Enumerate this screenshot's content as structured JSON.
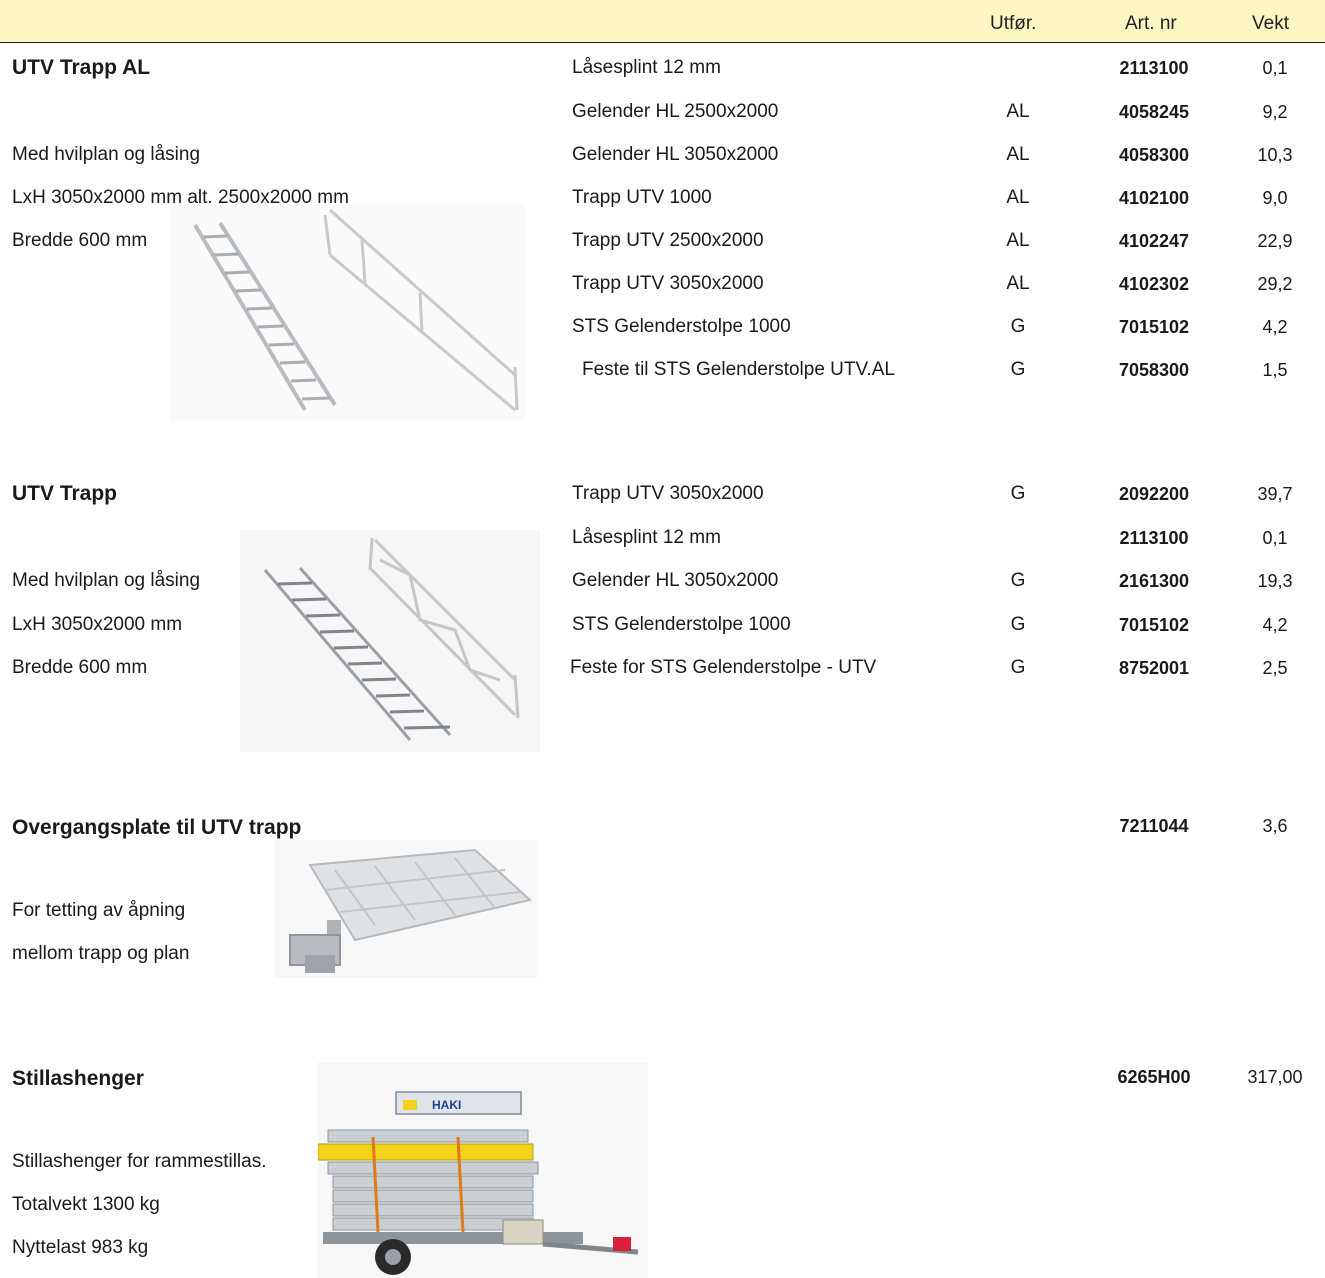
{
  "header": {
    "utfor": "Utfør.",
    "artnr": "Art. nr",
    "vekt": "Vekt"
  },
  "sections": [
    {
      "title": "UTV Trapp AL",
      "desc": [
        "Med hvilplan og låsing",
        "LxH 3050x2000 mm alt. 2500x2000 mm",
        "Bredde 600 mm"
      ],
      "rows": [
        {
          "name": "Låsesplint 12 mm",
          "utf": "",
          "art": "2113100",
          "vekt": "0,1"
        },
        {
          "name": "Gelender HL 2500x2000",
          "utf": "AL",
          "art": "4058245",
          "vekt": "9,2"
        },
        {
          "name": "Gelender HL 3050x2000",
          "utf": "AL",
          "art": "4058300",
          "vekt": "10,3"
        },
        {
          "name": "Trapp UTV 1000",
          "utf": "AL",
          "art": "4102100",
          "vekt": "9,0"
        },
        {
          "name": "Trapp UTV 2500x2000",
          "utf": "AL",
          "art": "4102247",
          "vekt": "22,9"
        },
        {
          "name": "Trapp UTV 3050x2000",
          "utf": "AL",
          "art": "4102302",
          "vekt": "29,2"
        },
        {
          "name": "STS Gelenderstolpe 1000",
          "utf": "G",
          "art": "7015102",
          "vekt": "4,2"
        },
        {
          "name": "Feste til STS Gelenderstolpe UTV.AL",
          "utf": "G",
          "art": "7058300",
          "vekt": "1,5"
        }
      ]
    },
    {
      "title": "UTV Trapp",
      "desc": [
        "Med hvilplan og låsing",
        "LxH 3050x2000 mm",
        "Bredde 600 mm"
      ],
      "rows": [
        {
          "name": "Trapp UTV 3050x2000",
          "utf": "G",
          "art": "2092200",
          "vekt": "39,7"
        },
        {
          "name": "Låsesplint 12 mm",
          "utf": "",
          "art": "2113100",
          "vekt": "0,1"
        },
        {
          "name": "Gelender HL 3050x2000",
          "utf": "G",
          "art": "2161300",
          "vekt": "19,3"
        },
        {
          "name": "STS Gelenderstolpe 1000",
          "utf": "G",
          "art": "7015102",
          "vekt": "4,2"
        },
        {
          "name": "Feste for STS Gelenderstolpe - UTV",
          "utf": "G",
          "art": "8752001",
          "vekt": "2,5"
        }
      ]
    },
    {
      "title": "Overgangsplate til UTV trapp",
      "desc": [
        "For tetting av åpning",
        "mellom trapp og plan"
      ],
      "rows": [
        {
          "name": "",
          "utf": "",
          "art": "7211044",
          "vekt": "3,6"
        }
      ]
    },
    {
      "title": "Stillashenger",
      "desc": [
        "Stillashenger for rammestillas.",
        "Totalvekt 1300 kg",
        "Nyttelast 983 kg"
      ],
      "rows": [
        {
          "name": "",
          "utf": "",
          "art": "6265H00",
          "vekt": "317,00"
        }
      ]
    }
  ],
  "trailer_logo": "HAKI",
  "colors": {
    "header_bg": "#fdf6c3",
    "trailer_yellow": "#f2d21a",
    "trailer_red": "#d8203a"
  }
}
